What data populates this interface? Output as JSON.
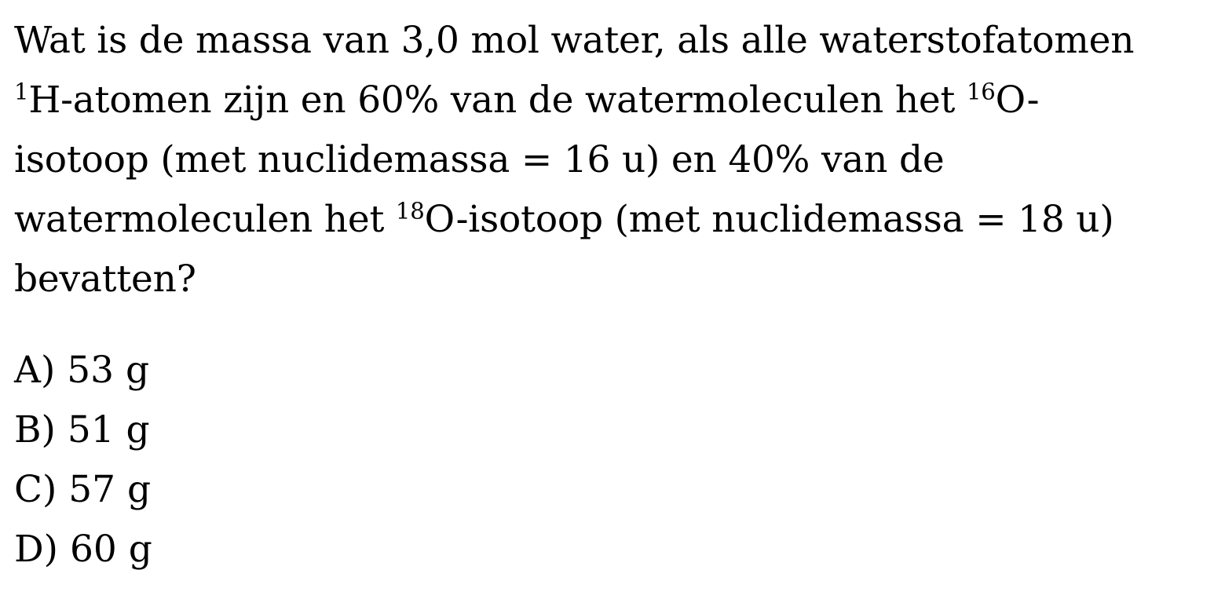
{
  "question": {
    "line1": "Wat is de massa van 3,0 mol water, als alle waterstofatomen",
    "line2": {
      "sup1": "1",
      "text1": "H-atomen zijn en 60% van de watermoleculen het ",
      "sup2": "16",
      "text2": "O-"
    },
    "line3": "isotoop (met nuclidemassa = 16 u) en 40% van de",
    "line4": {
      "text1": "watermoleculen het ",
      "sup1": "18",
      "text2": "O-isotoop (met nuclidemassa = 18 u)"
    },
    "line5": "bevatten?"
  },
  "options": [
    {
      "label": "A) 53 g"
    },
    {
      "label": "B) 51 g"
    },
    {
      "label": "C) 57 g"
    },
    {
      "label": "D) 60 g"
    }
  ]
}
